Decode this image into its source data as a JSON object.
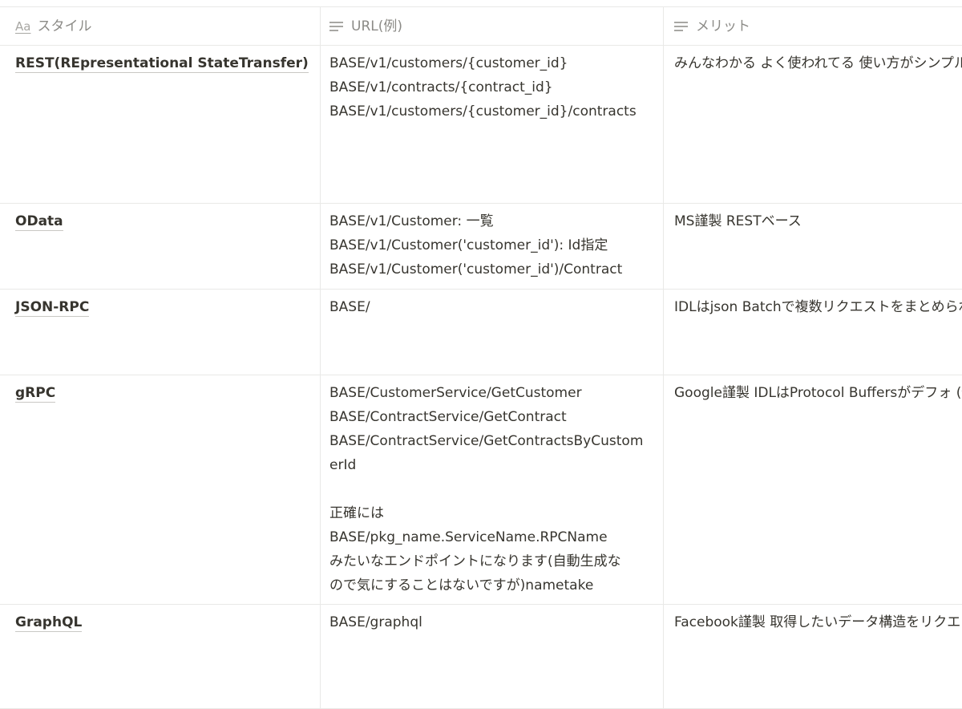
{
  "columns": {
    "style": "スタイル",
    "url": "URL(例)",
    "merit": "メリット",
    "style_icon": "Aa",
    "url_icon": "text-lines-icon",
    "merit_icon": "text-lines-icon"
  },
  "rows": [
    {
      "style": "REST(REpresentational StateTransfer)",
      "url": "BASE/v1/customers/{customer_id}\nBASE/v1/contracts/{contract_id}\nBASE/v1/customers/{customer_id}/contracts",
      "merit": "みんなわかる\nよく使われてる\n使い方がシンプル\n多分使う側の導入が簡単\n広く使われるようになってから長いので、す\nぐに廃れることは無さそう"
    },
    {
      "style": "OData",
      "url": "BASE/v1/Customer: 一覧\nBASE/v1/Customer('customer_id'): Id指定\nBASE/v1/Customer('customer_id')/Contract",
      "merit": "MS謹製\nRESTベース"
    },
    {
      "style": "JSON-RPC",
      "url": "BASE/",
      "merit": "IDLはjson\nBatchで複数リクエストをまとめられる\nシンプルなのでライブラリ実装も多い"
    },
    {
      "style": "gRPC",
      "url": "BASE/CustomerService/GetCustomer\nBASE/ContractService/GetContract\nBASE/ContractService/GetContractsByCustom\nerId\n\n正確には\nBASE/pkg_name.ServiceName.RPCName\nみたいなエンドポイントになります(自動生成な\nので気にすることはないですが)nametake",
      "merit": "Google謹製\nIDLはProtocol Buffersがデフォ\n(他も対応している)\n双方向通信ができる\nコードの自動生成に向いてる\n言語依存しないのでマイクロサービスで扱い\nやすい\n松川さんに知見がありそう"
    },
    {
      "style": "GraphQL",
      "url": "BASE/graphql",
      "merit": "Facebook謹製\n取得したいデータ構造をリクエスト側が指定\nできる\nIDLは独自"
    }
  ]
}
